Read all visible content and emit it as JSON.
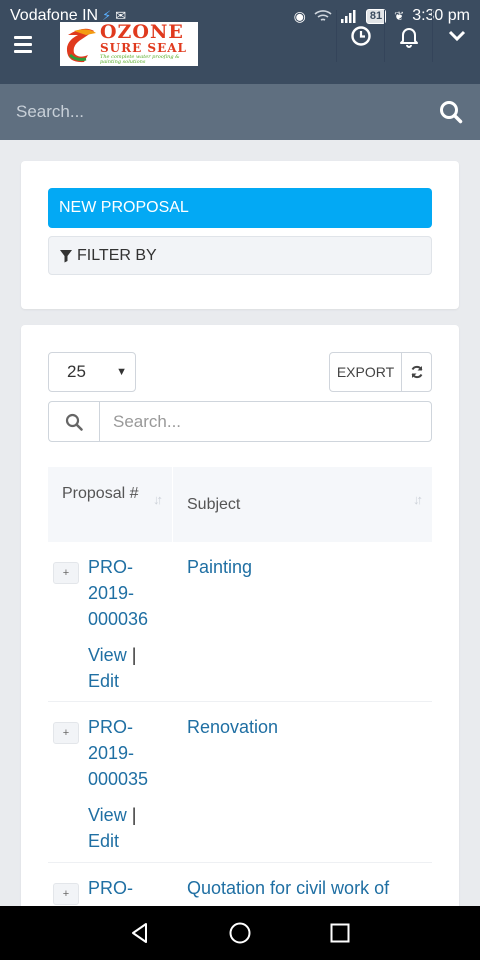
{
  "status_bar": {
    "carrier": "Vodafone IN",
    "battery": "81",
    "time": "3:30 pm"
  },
  "header": {
    "logo": {
      "line1": "OZONE",
      "line2": "SURE SEAL",
      "tagline": "The complete water proofing & painting solutions"
    }
  },
  "search": {
    "placeholder": "Search..."
  },
  "actions_card": {
    "new_proposal": "NEW PROPOSAL",
    "filter_by": "FILTER BY"
  },
  "table_controls": {
    "per_page": "25",
    "export": "EXPORT",
    "search_placeholder": "Search..."
  },
  "table": {
    "columns": [
      "Proposal #",
      "Subject"
    ],
    "rows": [
      {
        "proposal_lines": [
          "PRO-",
          "2019-",
          "000036"
        ],
        "view": "View",
        "separator": "|",
        "edit": "Edit",
        "subject": "Painting"
      },
      {
        "proposal_lines": [
          "PRO-",
          "2019-",
          "000035"
        ],
        "view": "View",
        "separator": "|",
        "edit": "Edit",
        "subject": "Renovation"
      },
      {
        "proposal_lines": [
          "PRO-"
        ],
        "view": "",
        "separator": "",
        "edit": "",
        "subject": "Quotation for civil work of"
      }
    ]
  },
  "colors": {
    "header_bg": "#3b4c60",
    "search_bg": "#5f6f80",
    "primary_button": "#03a9f4",
    "link": "#1f6fa3"
  }
}
